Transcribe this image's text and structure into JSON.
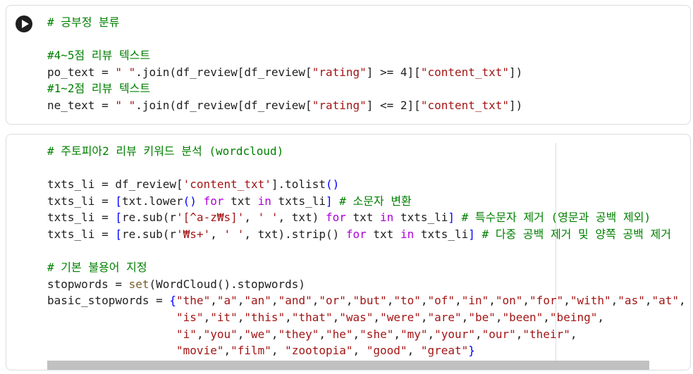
{
  "cell1": {
    "lines": [
      "# 긍부정 분류",
      "",
      "#4~5점 리뷰 텍스트",
      "po_text = \" \".join(df_review[df_review[\"rating\"] >= 4][\"content_txt\"])",
      "#1~2점 리뷰 텍스트",
      "ne_text = \" \".join(df_review[df_review[\"rating\"] <= 2][\"content_txt\"])"
    ]
  },
  "cell2": {
    "lines": [
      "# 주토피아2 리뷰 키워드 분석 (wordcloud)",
      "",
      "txts_li = df_review['content_txt'].tolist()",
      "txts_li = [txt.lower() for txt in txts_li] # 소문자 변환",
      "txts_li = [re.sub(r'[^a-z₩s]', ' ', txt) for txt in txts_li] # 특수문자 제거 (영문과 공백 제외)",
      "txts_li = [re.sub(r'₩s+', ' ', txt).strip() for txt in txts_li] # 다중 공백 제거 및 양쪽 공백 제거",
      "",
      "# 기본 불용어 지정",
      "stopwords = set(WordCloud().stopwords)",
      "basic_stopwords = {\"the\",\"a\",\"an\",\"and\",\"or\",\"but\",\"to\",\"of\",\"in\",\"on\",\"for\",\"with\",\"as\",\"at\",",
      "                   \"is\",\"it\",\"this\",\"that\",\"was\",\"were\",\"are\",\"be\",\"been\",\"being\",",
      "                   \"i\",\"you\",\"we\",\"they\",\"he\",\"she\",\"my\",\"your\",\"our\",\"their\",",
      "                   \"movie\",\"film\", \"zootopia\", \"good\", \"great\"}"
    ]
  }
}
